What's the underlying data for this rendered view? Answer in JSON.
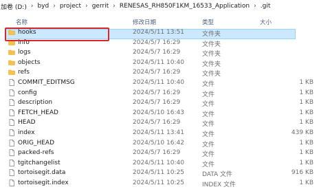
{
  "breadcrumb": [
    "加卷 (D:)",
    "byd",
    "project",
    "gerrit",
    "RENESAS_RH850F1KM_16533_Application",
    ".git"
  ],
  "columns": {
    "name": "名称",
    "date": "修改日期",
    "type": "类型",
    "size": "大小"
  },
  "files": [
    {
      "name": "hooks",
      "date": "2024/5/11 13:51",
      "type": "文件夹",
      "size": "",
      "icon": "folder-icon"
    },
    {
      "name": "info",
      "date": "2024/5/7 16:29",
      "type": "文件夹",
      "size": "",
      "icon": "folder-icon"
    },
    {
      "name": "logs",
      "date": "2024/5/7 16:29",
      "type": "文件夹",
      "size": "",
      "icon": "folder-icon"
    },
    {
      "name": "objects",
      "date": "2024/5/11 10:40",
      "type": "文件夹",
      "size": "",
      "icon": "folder-icon"
    },
    {
      "name": "refs",
      "date": "2024/5/7 16:29",
      "type": "文件夹",
      "size": "",
      "icon": "folder-icon"
    },
    {
      "name": "COMMIT_EDITMSG",
      "date": "2024/5/11 10:40",
      "type": "文件",
      "size": "1 KB",
      "icon": "file-icon"
    },
    {
      "name": "config",
      "date": "2024/5/7 16:29",
      "type": "文件",
      "size": "1 KB",
      "icon": "file-icon"
    },
    {
      "name": "description",
      "date": "2024/5/7 16:29",
      "type": "文件",
      "size": "1 KB",
      "icon": "file-icon"
    },
    {
      "name": "FETCH_HEAD",
      "date": "2024/5/10 16:43",
      "type": "文件",
      "size": "1 KB",
      "icon": "file-icon"
    },
    {
      "name": "HEAD",
      "date": "2024/5/7 16:29",
      "type": "文件",
      "size": "1 KB",
      "icon": "file-icon"
    },
    {
      "name": "index",
      "date": "2024/5/11 13:41",
      "type": "文件",
      "size": "439 KB",
      "icon": "file-icon"
    },
    {
      "name": "ORIG_HEAD",
      "date": "2024/5/10 16:42",
      "type": "文件",
      "size": "1 KB",
      "icon": "file-icon"
    },
    {
      "name": "packed-refs",
      "date": "2024/5/7 16:29",
      "type": "文件",
      "size": "1 KB",
      "icon": "file-icon"
    },
    {
      "name": "tgitchangelist",
      "date": "2024/5/11 10:40",
      "type": "文件",
      "size": "1 KB",
      "icon": "file-icon"
    },
    {
      "name": "tortoisegit.data",
      "date": "2024/5/11 10:25",
      "type": "DATA 文件",
      "size": "916 KB",
      "icon": "file-icon"
    },
    {
      "name": "tortoisegit.index",
      "date": "2024/5/11 10:25",
      "type": "INDEX 文件",
      "size": "1 KB",
      "icon": "file-icon"
    }
  ],
  "selected_index": 0,
  "colors": {
    "folder": "#f5c34d",
    "selection": "#cce8ff",
    "highlight_border": "#d9262b"
  }
}
